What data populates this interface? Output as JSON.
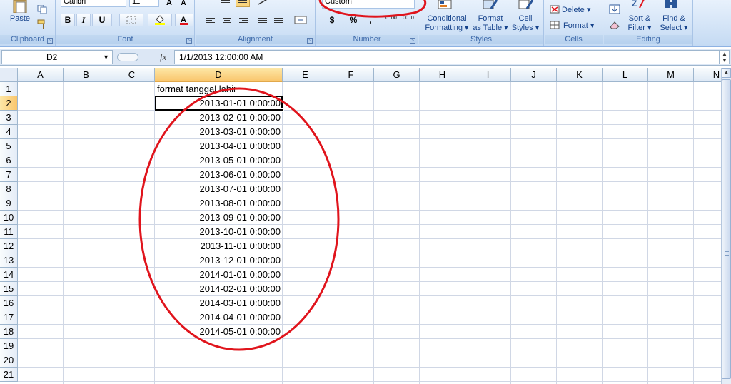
{
  "ribbon": {
    "clipboard": {
      "label": "Clipboard",
      "paste_label": "Paste"
    },
    "font": {
      "label": "Font",
      "font_name": "Calibri",
      "font_size": "11",
      "bold": "B",
      "italic": "I",
      "underline": "U"
    },
    "alignment": {
      "label": "Alignment"
    },
    "number": {
      "label": "Number",
      "format_value": "Custom",
      "currency": "$",
      "percent": "%",
      "comma": ",",
      "inc_decimal": ".0 .00",
      "dec_decimal": ".00 .0"
    },
    "styles": {
      "label": "Styles",
      "conditional_formatting": [
        "Conditional",
        "Formatting ▾"
      ],
      "format_as_table": [
        "Format",
        "as Table ▾"
      ],
      "cell_styles": [
        "Cell",
        "Styles ▾"
      ]
    },
    "cells": {
      "label": "Cells",
      "delete_label": "Delete ▾",
      "format_label": "Format ▾"
    },
    "editing": {
      "label": "Editing",
      "sort_filter": [
        "Sort &",
        "Filter ▾"
      ],
      "find_select": [
        "Find &",
        "Select ▾"
      ]
    }
  },
  "formula_bar": {
    "name_box": "D2",
    "fx": "fx",
    "value": "1/1/2013  12:00:00 AM"
  },
  "columns": [
    "A",
    "B",
    "C",
    "D",
    "E",
    "F",
    "G",
    "H",
    "I",
    "J",
    "K",
    "L",
    "M",
    "N"
  ],
  "rows": [
    "1",
    "2",
    "3",
    "4",
    "5",
    "6",
    "7",
    "8",
    "9",
    "10",
    "11",
    "12",
    "13",
    "14",
    "15",
    "16",
    "17",
    "18",
    "19",
    "20",
    "21"
  ],
  "selected": {
    "column": "D",
    "row": "2"
  },
  "cells": {
    "D1": "format tanggal lahir",
    "D_values": [
      "2013-01-01  0:00:00",
      "2013-02-01  0:00:00",
      "2013-03-01  0:00:00",
      "2013-04-01  0:00:00",
      "2013-05-01  0:00:00",
      "2013-06-01  0:00:00",
      "2013-07-01  0:00:00",
      "2013-08-01  0:00:00",
      "2013-09-01  0:00:00",
      "2013-10-01  0:00:00",
      "2013-11-01  0:00:00",
      "2013-12-01  0:00:00",
      "2014-01-01  0:00:00",
      "2014-02-01  0:00:00",
      "2014-03-01  0:00:00",
      "2014-04-01  0:00:00",
      "2014-05-01  0:00:00"
    ]
  },
  "colors": {
    "annotation": "#e0141c",
    "selection_header": "#f9c56b"
  }
}
